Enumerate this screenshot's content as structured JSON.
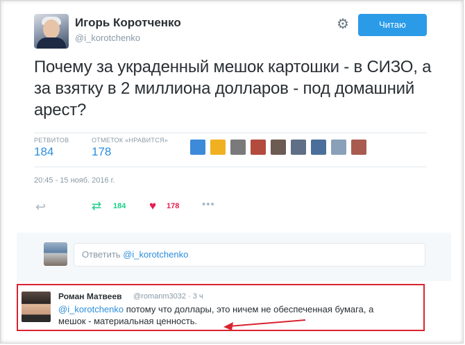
{
  "tweet": {
    "author_name": "Игорь Коротченко",
    "author_handle": "@i_korotchenko",
    "follow_label": "Читаю",
    "text": "Почему за украденный мешок картошки - в СИЗО, а за взятку в 2 миллиона долларов - под домашний арест?",
    "stats": {
      "retweets_label": "РЕТВИТОВ",
      "retweets_value": "184",
      "likes_label": "ОТМЕТОК «НРАВИТСЯ»",
      "likes_value": "178"
    },
    "timestamp": "20:45 - 15 нояб. 2016 г.",
    "actions": {
      "retweet_count": "184",
      "like_count": "178"
    }
  },
  "reply_box": {
    "prefix": "Ответить",
    "mention": "@i_korotchenko"
  },
  "reply_tweet": {
    "author_name": "Роман Матвеев",
    "author_handle": "@romanm3032 · 3 ч",
    "mention": "@i_korotchenko",
    "text_line1_rest": " потому что доллары, это ничем не обеспеченная бумага, а",
    "text_line2": "мешок -  материальная ценность."
  },
  "colors": {
    "accent_blue": "#2b9be8",
    "retweet_green": "#19cf86",
    "like_red": "#e81c4f",
    "highlight_red": "#d9232f"
  },
  "favoriters": [
    "#3c8ad8",
    "#f0b020",
    "#7a7a7a",
    "#b34a3e",
    "#6b5b52",
    "#5f6f85",
    "#4a6f9a",
    "#8aa0b8",
    "#a85b4e"
  ]
}
